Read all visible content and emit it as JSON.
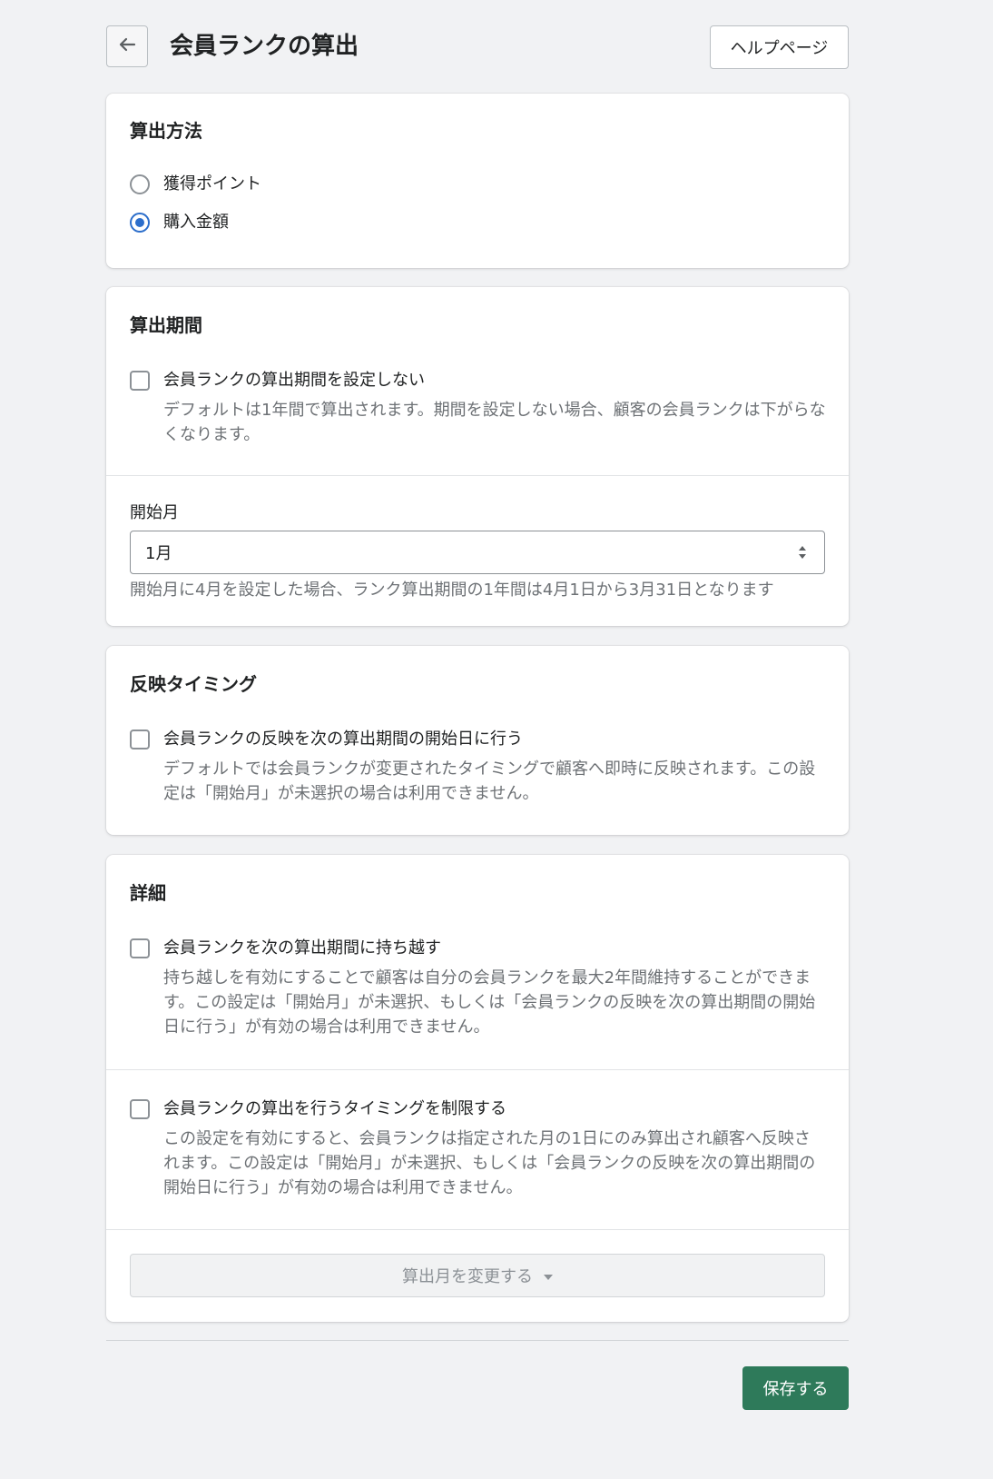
{
  "header": {
    "back_icon": "arrow-left-icon",
    "title": "会員ランクの算出",
    "help_button": "ヘルプページ"
  },
  "method": {
    "title": "算出方法",
    "options": [
      {
        "label": "獲得ポイント",
        "checked": false
      },
      {
        "label": "購入金額",
        "checked": true
      }
    ]
  },
  "period": {
    "title": "算出期間",
    "no_period": {
      "label": "会員ランクの算出期間を設定しない",
      "checked": false,
      "help": "デフォルトは1年間で算出されます。期間を設定しない場合、顧客の会員ランクは下がらなくなります。"
    },
    "start_month": {
      "label": "開始月",
      "value": "1月",
      "help": "開始月に4月を設定した場合、ランク算出期間の1年間は4月1日から3月31日となります"
    }
  },
  "timing": {
    "title": "反映タイミング",
    "option": {
      "label": "会員ランクの反映を次の算出期間の開始日に行う",
      "checked": false,
      "help": "デフォルトでは会員ランクが変更されたタイミングで顧客へ即時に反映されます。この設定は「開始月」が未選択の場合は利用できません。"
    }
  },
  "details": {
    "title": "詳細",
    "carry_over": {
      "label": "会員ランクを次の算出期間に持ち越す",
      "checked": false,
      "help": "持ち越しを有効にすることで顧客は自分の会員ランクを最大2年間維持することができます。この設定は「開始月」が未選択、もしくは「会員ランクの反映を次の算出期間の開始日に行う」が有効の場合は利用できません。"
    },
    "limit_timing": {
      "label": "会員ランクの算出を行うタイミングを制限する",
      "checked": false,
      "help": "この設定を有効にすると、会員ランクは指定された月の1日にのみ算出され顧客へ反映されます。この設定は「開始月」が未選択、もしくは「会員ランクの反映を次の算出期間の開始日に行う」が有効の場合は利用できません。"
    },
    "change_month_button": "算出月を変更する"
  },
  "footer": {
    "save_button": "保存する"
  },
  "colors": {
    "background": "#f1f2f4",
    "primary": "#2e7a5a",
    "radio_selected": "#2c6ecb"
  }
}
